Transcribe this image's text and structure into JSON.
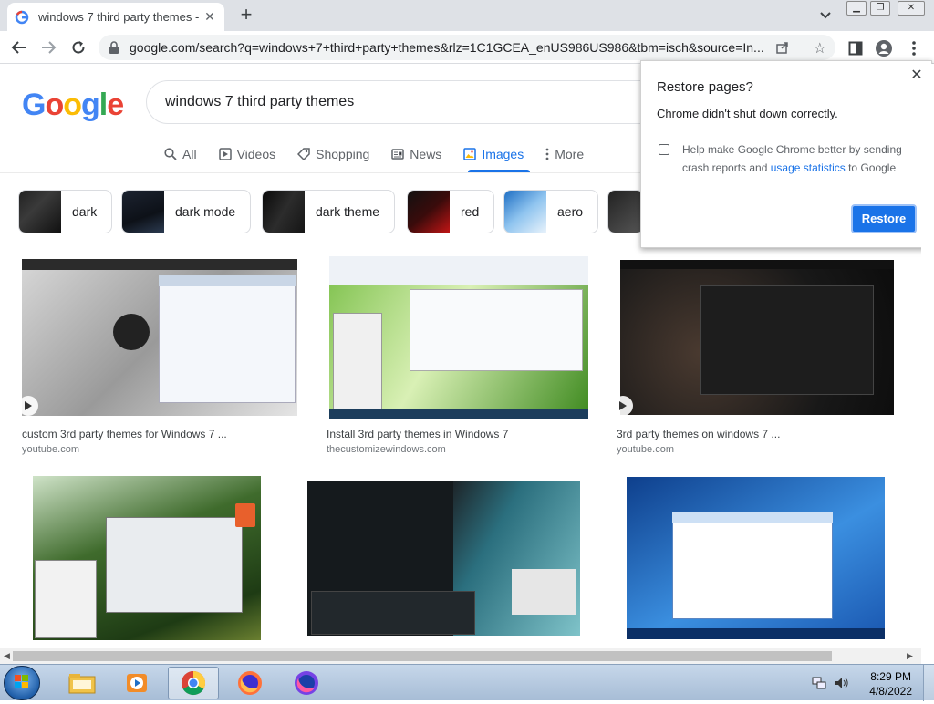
{
  "browser": {
    "tab_title": "windows 7 third party themes - C",
    "url": "google.com/search?q=windows+7+third+party+themes&rlz=1C1GCEA_enUS986US986&tbm=isch&source=In..."
  },
  "google": {
    "logo": {
      "G": "G",
      "o1": "o",
      "o2": "o",
      "g": "g",
      "l": "l",
      "e": "e"
    },
    "query": "windows 7 third party themes",
    "tabs": {
      "all": "All",
      "videos": "Videos",
      "shopping": "Shopping",
      "news": "News",
      "images": "Images",
      "more": "More"
    },
    "chips": [
      {
        "label": "dark"
      },
      {
        "label": "dark mode"
      },
      {
        "label": "dark theme"
      },
      {
        "label": "red"
      },
      {
        "label": "aero"
      }
    ],
    "results": [
      {
        "title": "custom 3rd party themes for Windows 7 ...",
        "source": "youtube.com"
      },
      {
        "title": "Install 3rd party themes in Windows 7",
        "source": "thecustomizewindows.com"
      },
      {
        "title": "3rd party themes on windows 7 ...",
        "source": "youtube.com"
      },
      {
        "title": "",
        "source": ""
      },
      {
        "title": "",
        "source": ""
      },
      {
        "title": "",
        "source": ""
      }
    ]
  },
  "restore_popup": {
    "title": "Restore pages?",
    "message": "Chrome didn't shut down correctly.",
    "checkbox_text_before": "Help make Google Chrome better by sending crash reports and ",
    "checkbox_link": "usage statistics",
    "checkbox_text_after": " to Google",
    "button": "Restore"
  },
  "taskbar": {
    "time": "8:29 PM",
    "date": "4/8/2022"
  },
  "colors": {
    "accent": "#1a73e8",
    "google_blue": "#4285f4",
    "google_red": "#ea4335",
    "google_yellow": "#fbbc05",
    "google_green": "#34a853"
  }
}
